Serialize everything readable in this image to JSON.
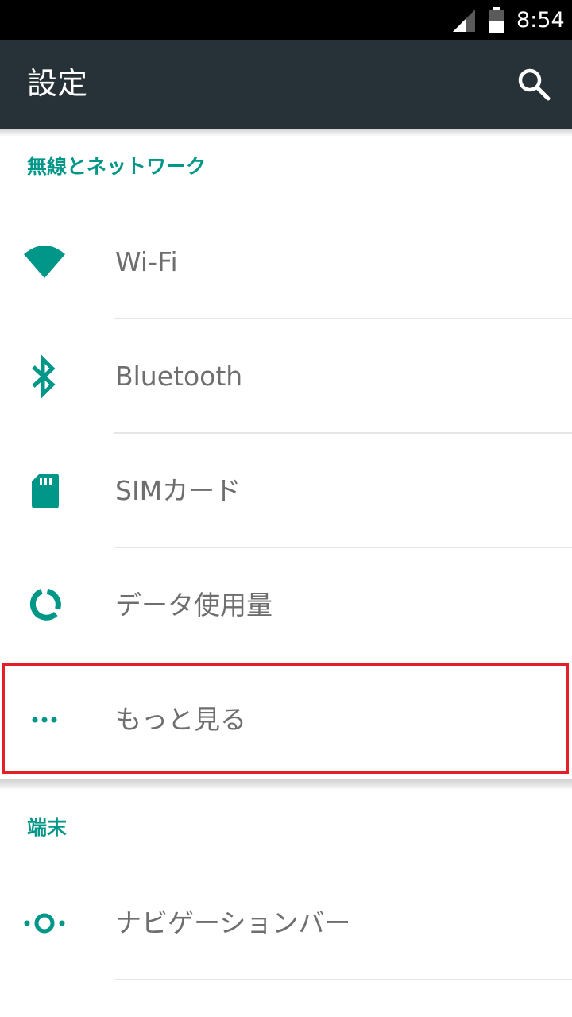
{
  "status_bar": {
    "time": "8:54",
    "signal_icon": "cell-signal-icon",
    "battery_icon": "battery-icon"
  },
  "app_bar": {
    "title": "設定",
    "search_icon": "search-icon"
  },
  "sections": [
    {
      "header": "無線とネットワーク",
      "items": [
        {
          "label": "Wi-Fi",
          "icon": "wifi-icon"
        },
        {
          "label": "Bluetooth",
          "icon": "bluetooth-icon"
        },
        {
          "label": "SIMカード",
          "icon": "sim-card-icon"
        },
        {
          "label": "データ使用量",
          "icon": "data-usage-icon"
        },
        {
          "label": "もっと見る",
          "icon": "more-dots-icon"
        }
      ]
    },
    {
      "header": "端末",
      "items": [
        {
          "label": "ナビゲーションバー",
          "icon": "navigation-bar-icon"
        }
      ]
    }
  ],
  "colors": {
    "accent": "#009688",
    "app_bar": "#263238",
    "status_bar": "#000000",
    "highlight": "#e3202a",
    "label_text": "#6e6e6e"
  }
}
